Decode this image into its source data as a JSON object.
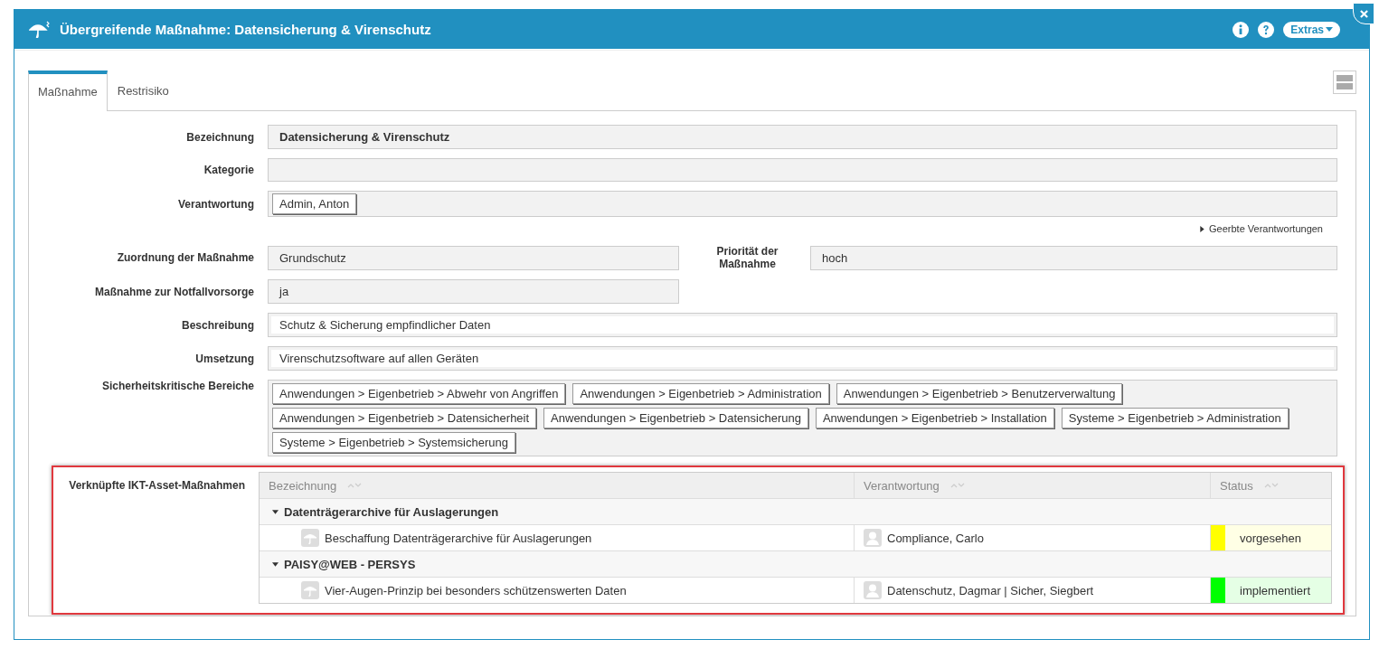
{
  "window": {
    "title": "Übergreifende Maßnahme: Datensicherung & Virenschutz",
    "extras_button": "Extras"
  },
  "tabs": [
    {
      "label": "Maßnahme",
      "selected": true
    },
    {
      "label": "Restrisiko",
      "selected": false
    }
  ],
  "form": {
    "bezeichnung": {
      "label": "Bezeichnung",
      "value": "Datensicherung & Virenschutz"
    },
    "kategorie": {
      "label": "Kategorie"
    },
    "verantwortung": {
      "label": "Verantwortung",
      "chips": [
        "Admin, Anton"
      ],
      "link": "Geerbte Verantwortungen"
    },
    "zuordnung": {
      "label": "Zuordnung der Maßnahme",
      "value": "Grundschutz"
    },
    "prioritaet": {
      "label": "Priorität der Maßnahme",
      "value": "hoch"
    },
    "notfall": {
      "label": "Maßnahme zur Notfallvorsorge",
      "value": "ja"
    },
    "beschreibung": {
      "label": "Beschreibung",
      "value": "Schutz & Sicherung empfindlicher Daten"
    },
    "umsetzung": {
      "label": "Umsetzung",
      "value": "Virenschutzsoftware auf allen Geräten"
    },
    "bereiche": {
      "label": "Sicherheitskritische Bereiche",
      "chips": [
        "Anwendungen > Eigenbetrieb > Abwehr von Angriffen",
        "Anwendungen > Eigenbetrieb > Administration",
        "Anwendungen > Eigenbetrieb > Benutzerverwaltung",
        "Anwendungen > Eigenbetrieb > Datensicherheit",
        "Anwendungen > Eigenbetrieb > Datensicherung",
        "Anwendungen > Eigenbetrieb > Installation",
        "Systeme > Eigenbetrieb > Administration",
        "Systeme > Eigenbetrieb > Systemsicherung"
      ]
    }
  },
  "linked": {
    "label": "Verknüpfte IKT-Asset-Maßnahmen",
    "columns": [
      "Bezeichnung",
      "Verantwortung",
      "Status"
    ],
    "groups": [
      {
        "name": "Datenträgerarchive für Auslagerungen",
        "expanded": true,
        "children": [
          {
            "name": "Beschaffung Datenträgerarchive für Auslagerungen",
            "owner": "Compliance, Carlo",
            "status": "vorgesehen",
            "color": "#ffff00"
          }
        ]
      },
      {
        "name": "PAISY@WEB - PERSYS",
        "expanded": true,
        "children": [
          {
            "name": "Vier-Augen-Prinzip bei besonders schützenswerten Daten",
            "owner": "Datenschutz, Dagmar | Sicher, Siegbert",
            "status": "implementiert",
            "color": "#00ff00"
          }
        ]
      }
    ]
  }
}
